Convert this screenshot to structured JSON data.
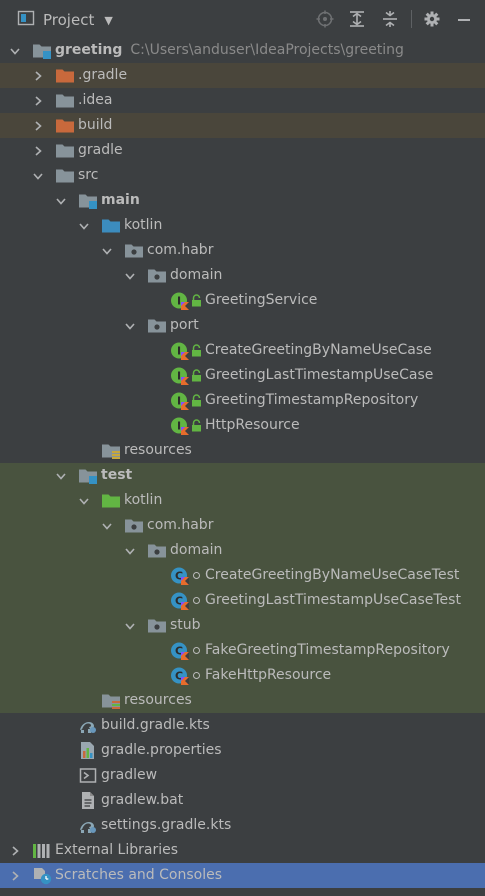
{
  "header": {
    "title": "Project",
    "tools": [
      "locate-icon",
      "expand-all-icon",
      "collapse-all-icon",
      "gear-icon",
      "minimize-icon"
    ]
  },
  "tree": [
    {
      "label": "greeting",
      "extra": "C:\\Users\\anduser\\IdeaProjects\\greeting",
      "level": 0,
      "expanded": true,
      "icon": "module",
      "bold": true,
      "bg": "none"
    },
    {
      "label": ".gradle",
      "level": 1,
      "expanded": false,
      "icon": "folder-orange",
      "bg": "excluded"
    },
    {
      "label": ".idea",
      "level": 1,
      "expanded": false,
      "icon": "folder",
      "bg": "none"
    },
    {
      "label": "build",
      "level": 1,
      "expanded": false,
      "icon": "folder-orange",
      "bg": "excluded"
    },
    {
      "label": "gradle",
      "level": 1,
      "expanded": false,
      "icon": "folder",
      "bg": "none"
    },
    {
      "label": "src",
      "level": 1,
      "expanded": true,
      "icon": "folder",
      "bg": "none"
    },
    {
      "label": "main",
      "level": 2,
      "expanded": true,
      "icon": "module-folder",
      "bold": true,
      "bg": "none"
    },
    {
      "label": "kotlin",
      "level": 3,
      "expanded": true,
      "icon": "folder-blue",
      "bg": "none"
    },
    {
      "label": "com.habr",
      "level": 4,
      "expanded": true,
      "icon": "package",
      "bg": "none"
    },
    {
      "label": "domain",
      "level": 5,
      "expanded": true,
      "icon": "package",
      "bg": "none"
    },
    {
      "label": "GreetingService",
      "level": 6,
      "icon": "kotlin-interface",
      "lock": true,
      "bg": "none"
    },
    {
      "label": "port",
      "level": 5,
      "expanded": true,
      "icon": "package",
      "bg": "none"
    },
    {
      "label": "CreateGreetingByNameUseCase",
      "level": 6,
      "icon": "kotlin-interface",
      "lock": true,
      "bg": "none"
    },
    {
      "label": "GreetingLastTimestampUseCase",
      "level": 6,
      "icon": "kotlin-interface",
      "lock": true,
      "bg": "none"
    },
    {
      "label": "GreetingTimestampRepository",
      "level": 6,
      "icon": "kotlin-interface",
      "lock": true,
      "bg": "none"
    },
    {
      "label": "HttpResource",
      "level": 6,
      "icon": "kotlin-interface",
      "lock": true,
      "bg": "none"
    },
    {
      "label": "resources",
      "level": 3,
      "icon": "resources-folder",
      "bg": "none"
    },
    {
      "label": "test",
      "level": 2,
      "expanded": true,
      "icon": "module-folder",
      "bold": true,
      "bg": "test"
    },
    {
      "label": "kotlin",
      "level": 3,
      "expanded": true,
      "icon": "folder-green",
      "bg": "test"
    },
    {
      "label": "com.habr",
      "level": 4,
      "expanded": true,
      "icon": "package",
      "bg": "test"
    },
    {
      "label": "domain",
      "level": 5,
      "expanded": true,
      "icon": "package",
      "bg": "test"
    },
    {
      "label": "CreateGreetingByNameUseCaseTest",
      "level": 6,
      "icon": "kotlin-class",
      "dot": true,
      "bg": "test"
    },
    {
      "label": "GreetingLastTimestampUseCaseTest",
      "level": 6,
      "icon": "kotlin-class",
      "dot": true,
      "bg": "test"
    },
    {
      "label": "stub",
      "level": 5,
      "expanded": true,
      "icon": "package",
      "bg": "test"
    },
    {
      "label": "FakeGreetingTimestampRepository",
      "level": 6,
      "icon": "kotlin-class",
      "dot": true,
      "bg": "test"
    },
    {
      "label": "FakeHttpResource",
      "level": 6,
      "icon": "kotlin-class",
      "dot": true,
      "bg": "test"
    },
    {
      "label": "resources",
      "level": 3,
      "icon": "test-resources-folder",
      "bg": "test"
    },
    {
      "label": "build.gradle.kts",
      "level": 2,
      "icon": "gradle-file",
      "bg": "none"
    },
    {
      "label": "gradle.properties",
      "level": 2,
      "icon": "properties-file",
      "bg": "none"
    },
    {
      "label": "gradlew",
      "level": 2,
      "icon": "shell-file",
      "bg": "none"
    },
    {
      "label": "gradlew.bat",
      "level": 2,
      "icon": "text-file",
      "bg": "none"
    },
    {
      "label": "settings.gradle.kts",
      "level": 2,
      "icon": "gradle-file",
      "bg": "none"
    },
    {
      "label": "External Libraries",
      "level": 0,
      "expanded": false,
      "icon": "libraries",
      "bg": "none"
    },
    {
      "label": "Scratches and Consoles",
      "level": 0,
      "expanded": false,
      "icon": "scratches",
      "bg": "selected"
    }
  ],
  "colors": {
    "panel_bg": "#3c3f41",
    "excluded_bg": "#4a463b",
    "test_bg": "#49533f",
    "selected_bg": "#4b6eaf",
    "folder": "#87939a",
    "folder_orange": "#c8693c",
    "folder_blue": "#3c8cbe",
    "folder_green": "#62b543",
    "text": "#bbbbbb"
  }
}
